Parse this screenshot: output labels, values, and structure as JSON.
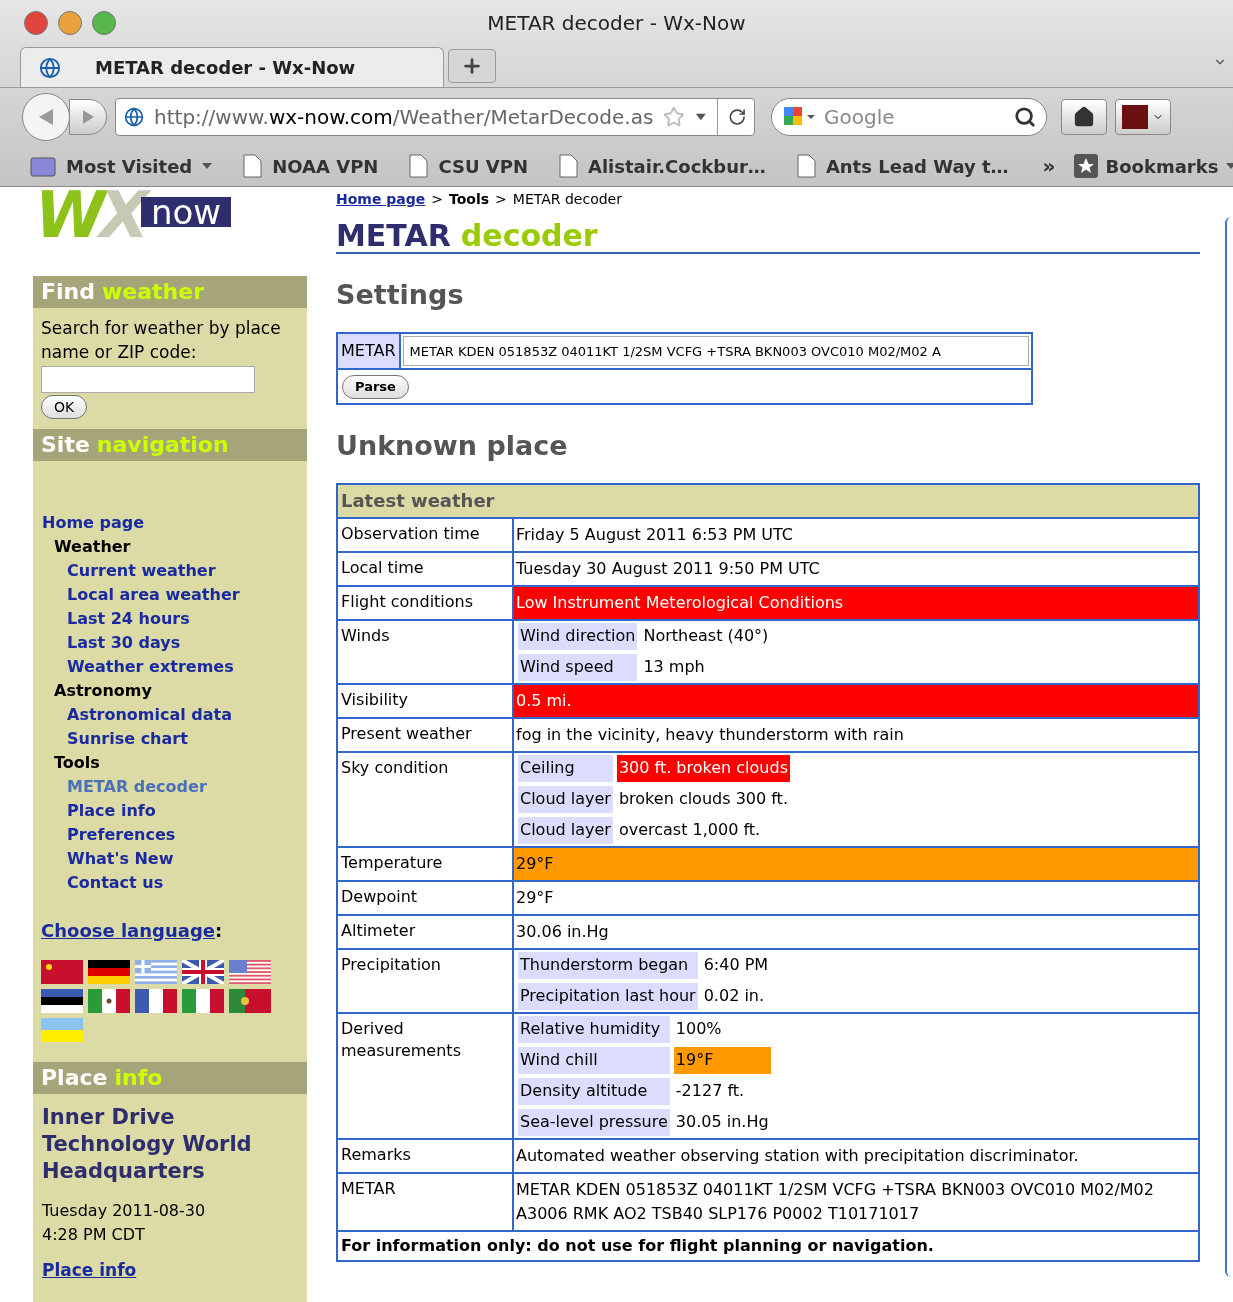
{
  "browser": {
    "title": "METAR decoder - Wx-Now",
    "tabs": [
      {
        "title": "METAR decoder - Wx-Now",
        "selected": true
      }
    ],
    "url": {
      "scheme": "http://www.",
      "domain": "wx-now.com",
      "path": "/Weather/MetarDecode.as"
    },
    "search_placeholder": "Google",
    "bookmarks": [
      {
        "label": "Most Visited",
        "kind": "folder"
      },
      {
        "label": "NOAA VPN",
        "kind": "page"
      },
      {
        "label": "CSU VPN",
        "kind": "page"
      },
      {
        "label": "Alistair.Cockbur…",
        "kind": "page"
      },
      {
        "label": "Ants Lead Way t…",
        "kind": "page"
      }
    ],
    "overflow": "»",
    "bookmarks_menu": "Bookmarks"
  },
  "logo": {
    "letters": [
      "W",
      "X"
    ],
    "tag": "now"
  },
  "sidebar": {
    "find": {
      "title": [
        "Find",
        "weather"
      ],
      "prompt": "Search for weather by place name or ZIP code:",
      "button": "OK"
    },
    "nav": {
      "title": [
        "Site",
        "navigation"
      ],
      "items": [
        {
          "label": "Home page",
          "kind": "link",
          "selected": false
        },
        {
          "label": "Weather",
          "kind": "group",
          "selected": false,
          "children": [
            {
              "label": "Current weather",
              "selected": false
            },
            {
              "label": "Local area weather",
              "selected": false
            },
            {
              "label": "Last 24 hours",
              "selected": false
            },
            {
              "label": "Last 30 days",
              "selected": false
            },
            {
              "label": "Weather extremes",
              "selected": false
            }
          ]
        },
        {
          "label": "Astronomy",
          "kind": "group",
          "selected": false,
          "children": [
            {
              "label": "Astronomical data",
              "selected": false
            },
            {
              "label": "Sunrise chart",
              "selected": false
            }
          ]
        },
        {
          "label": "Tools",
          "kind": "group",
          "selected": false,
          "children": [
            {
              "label": "METAR decoder",
              "selected": true
            },
            {
              "label": "Place info",
              "selected": false
            },
            {
              "label": "Preferences",
              "selected": false
            },
            {
              "label": "What's New",
              "selected": false
            },
            {
              "label": "Contact us",
              "selected": false
            }
          ]
        }
      ]
    },
    "language": {
      "link": "Choose language",
      "suffix": ":"
    },
    "place": {
      "title": [
        "Place",
        "info"
      ],
      "name": "Inner Drive Technology World Headquarters",
      "date": "Tuesday 2011-08-30",
      "time": "4:28 PM CDT",
      "link": "Place info"
    }
  },
  "main": {
    "breadcrumb": [
      {
        "text": "Home page",
        "kind": "link"
      },
      {
        "text": "Tools",
        "kind": "bold"
      },
      {
        "text": "METAR decoder",
        "kind": "plain"
      }
    ],
    "separator": ">",
    "title": [
      "METAR",
      "decoder"
    ],
    "settings": {
      "heading": "Settings",
      "label": "METAR",
      "value": "METAR KDEN 051853Z 04011KT 1/2SM VCFG +TSRA BKN003 OVC010 M02/M02 A",
      "button": "Parse"
    },
    "place_heading": "Unknown place",
    "table": {
      "caption": "Latest weather",
      "rows": [
        {
          "label": "Observation time",
          "kind": "text",
          "value": "Friday 5 August 2011 6:53 PM UTC"
        },
        {
          "label": "Local time",
          "kind": "text",
          "value": "Tuesday 30 August 2011 9:50 PM UTC"
        },
        {
          "label": "Flight conditions",
          "kind": "text",
          "value": "Low Instrument Meterological Conditions",
          "color": "#ff0000"
        },
        {
          "label": "Winds",
          "kind": "list",
          "items": [
            {
              "label": "Wind direction",
              "value": "Northeast (40°)"
            },
            {
              "label": "Wind speed",
              "value": "13 mph"
            }
          ]
        },
        {
          "label": "Visibility",
          "kind": "text",
          "value": "0.5 mi.",
          "color": "#ff0000"
        },
        {
          "label": "Present weather",
          "kind": "text",
          "value": "fog in the vicinity, heavy thunderstorm with rain"
        },
        {
          "label": "Sky condition",
          "kind": "list",
          "items": [
            {
              "label": "Ceiling",
              "value": "300 ft. broken clouds",
              "color": "#ff0000"
            },
            {
              "label": "Cloud layer",
              "value": "broken clouds 300 ft."
            },
            {
              "label": "Cloud layer",
              "value": "overcast 1,000 ft."
            }
          ]
        },
        {
          "label": "Temperature",
          "kind": "text",
          "value": "29°F",
          "color": "#ff9900"
        },
        {
          "label": "Dewpoint",
          "kind": "text",
          "value": "29°F"
        },
        {
          "label": "Altimeter",
          "kind": "text",
          "value": "30.06 in.Hg"
        },
        {
          "label": "Precipitation",
          "kind": "list",
          "items": [
            {
              "label": "Thunderstorm began",
              "value": "6:40 PM"
            },
            {
              "label": "Precipitation last hour",
              "value": "0.02 in."
            }
          ]
        },
        {
          "label": "Derived measurements",
          "kind": "list",
          "items": [
            {
              "label": "Relative humidity",
              "value": "100%"
            },
            {
              "label": "Wind chill",
              "value": "19°F",
              "color": "#ff9900"
            },
            {
              "label": "Density altitude",
              "value": "-2127 ft."
            },
            {
              "label": "Sea-level pressure",
              "value": "30.05 in.Hg"
            }
          ]
        },
        {
          "label": "Remarks",
          "kind": "text",
          "value": "Automated weather observing station with precipitation discriminator."
        },
        {
          "label": "METAR",
          "kind": "text",
          "value": "METAR KDEN 051853Z 04011KT 1/2SM VCFG +TSRA BKN003 OVC010 M02/M02 A3006 RMK AO2 TSB40 SLP176 P0002 T10171017"
        }
      ],
      "footer": "For information only: do not use for flight planning or navigation."
    }
  }
}
